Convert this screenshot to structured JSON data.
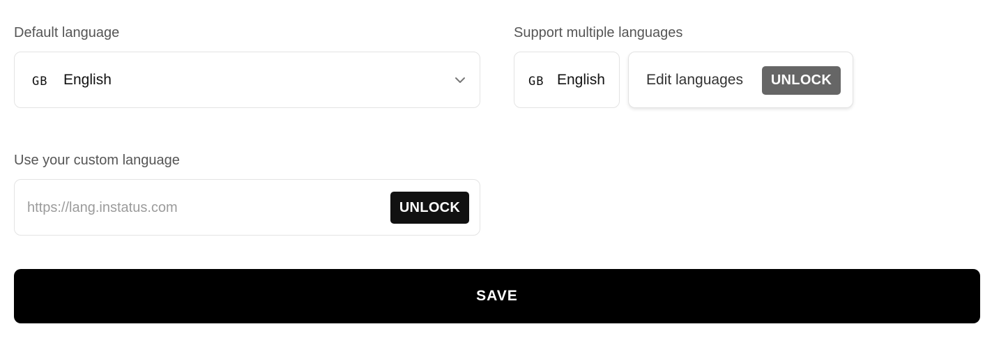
{
  "default_language": {
    "label": "Default language",
    "flag": "GB",
    "selected": "English",
    "dropdown_icon": "chevron-down-icon"
  },
  "multiple_languages": {
    "label": "Support multiple languages",
    "flag": "GB",
    "language": "English",
    "edit_label": "Edit languages",
    "unlock_label": "UNLOCK",
    "unlock_color": "#666666"
  },
  "custom_language": {
    "label": "Use your custom language",
    "placeholder": "https://lang.instatus.com",
    "unlock_label": "UNLOCK",
    "unlock_color": "#111111"
  },
  "save_label": "SAVE"
}
